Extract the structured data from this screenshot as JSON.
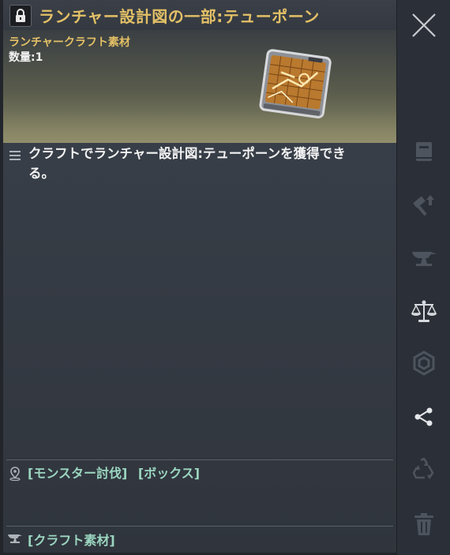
{
  "item": {
    "title": "ランチャー設計図の一部:テューポーン",
    "category": "ランチャークラフト素材",
    "quantity": "数量:1",
    "description": "クラフトでランチャー設計図:テューポーンを獲得できる。",
    "sources": [
      "[モンスター討伐]",
      "[ボックス]"
    ],
    "type_tag": "[クラフト素材]"
  },
  "icons": {
    "lock": "lock-icon",
    "item_image": "blueprint-fragment-icon",
    "description": "list-icon",
    "source": "location-pin-icon",
    "type": "anvil-icon"
  },
  "sidebar": [
    {
      "name": "close-icon"
    },
    {
      "name": "book-icon"
    },
    {
      "name": "hammer-upgrade-icon"
    },
    {
      "name": "anvil-icon"
    },
    {
      "name": "scale-icon"
    },
    {
      "name": "hexagon-icon"
    },
    {
      "name": "share-icon"
    },
    {
      "name": "recycle-icon"
    },
    {
      "name": "trash-icon"
    }
  ],
  "colors": {
    "title_gold": "#e3c066",
    "source_green": "#9bd6c0",
    "panel_bg": "#363c45",
    "sidebar_bg": "#2b3038"
  }
}
